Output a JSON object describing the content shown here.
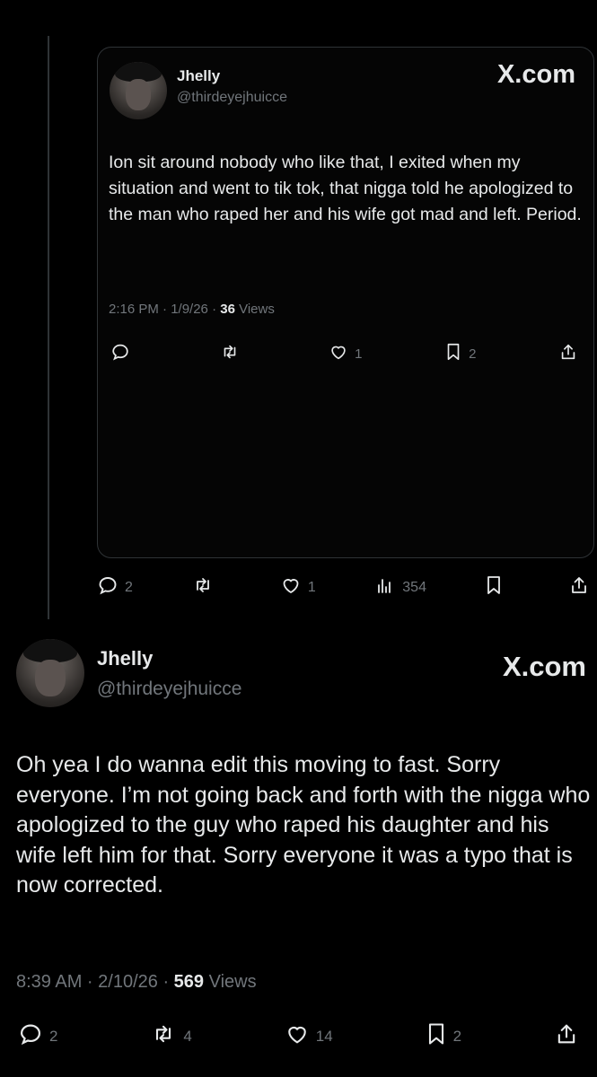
{
  "quoted_post": {
    "author_name": "Jhelly",
    "author_handle": "@thirdeyejhuicce",
    "source": "X.com",
    "text": "Ion sit around nobody who like that, I exited when my situation and went to tik tok, that nigga told he apologized to the man who raped her and his wife got mad and left. Period.",
    "time_date": "2:16 PM · 1/9/26 · ",
    "views_count": "36",
    "views_label": " Views",
    "actions": {
      "reply": "",
      "repost": "",
      "like": "1",
      "bookmark": "2",
      "share": ""
    }
  },
  "outer_actions": {
    "reply": "2",
    "repost": "",
    "like": "1",
    "views": "354",
    "bookmark": "",
    "share": ""
  },
  "main_post": {
    "author_name": "Jhelly",
    "author_handle": "@thirdeyejhuicce",
    "source": "X.com",
    "text": "Oh yea I do wanna edit this moving to fast. Sorry everyone. I’m not going back and forth with the nigga who apologized to the guy who raped his daughter and his wife left him for that. Sorry everyone it was a typo that is now corrected.",
    "time_date": "8:39 AM · 2/10/26 · ",
    "views_count": "569",
    "views_label": " Views",
    "actions": {
      "reply": "2",
      "repost": "4",
      "like": "14",
      "bookmark": "2",
      "share": ""
    }
  },
  "colors": {
    "background": "#000000",
    "text": "#e7e9ea",
    "secondary_text": "#71767b",
    "border": "#2f3336"
  },
  "icons": {
    "reply": "reply-icon",
    "repost": "repost-icon",
    "like": "heart-icon",
    "views": "views-icon",
    "bookmark": "bookmark-icon",
    "share": "share-icon"
  }
}
